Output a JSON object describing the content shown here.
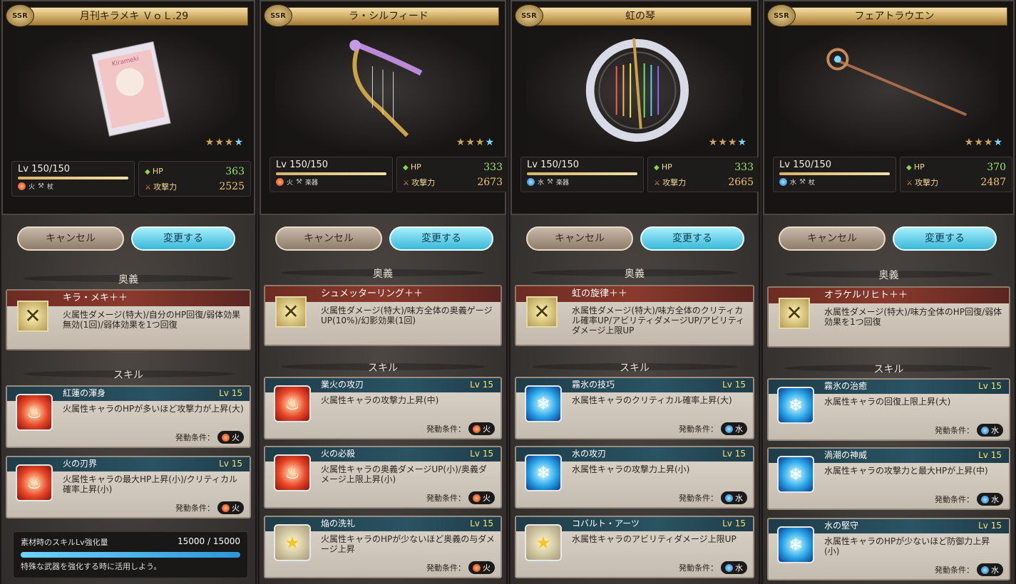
{
  "rarity_label": "SSR",
  "common": {
    "cancel": "キャンセル",
    "change": "変更する",
    "ougi_label": "奥義",
    "skill_label": "スキル",
    "trigger_label": "発動条件：",
    "hp_label": "HP",
    "atk_label": "攻撃力",
    "stars_gold": "★★★",
    "stars_blue": "★"
  },
  "colors": {
    "fire": "#d23a10",
    "water": "#1673c7",
    "gold": "#caa55c",
    "hp": "#9be86a"
  },
  "panels": [
    {
      "title": "月刊キラメキ ＶｏＬ.29",
      "level": "Lv 150/150",
      "element": "火",
      "element_icon": "fire-icon",
      "weapon_type": "杖",
      "hp": "363",
      "atk": "2525",
      "ougi": {
        "name": "キラ・メキ＋＋",
        "desc": "火属性ダメージ(特大)/自分のHP回復/弱体効果無効(1回)/弱体効果を1つ回復"
      },
      "skills": [
        {
          "name": "紅蓮の渾身",
          "lv": "Lv 15",
          "desc": "火属性キャラのHPが多いほど攻撃力が上昇(大)",
          "cond": "火",
          "icon": "fire-icon"
        },
        {
          "name": "火の刃界",
          "lv": "Lv 15",
          "desc": "火属性キャラの最大HP上昇(小)/クリティカル確率上昇(小)",
          "cond": "火",
          "icon": "fire-icon"
        }
      ],
      "material": {
        "label": "素材時のスキルLv強化量",
        "value": "15000 / 15000",
        "fill": 1.0,
        "note": "特殊な武器を強化する時に活用しよう。"
      }
    },
    {
      "title": "ラ・シルフィード",
      "level": "Lv 150/150",
      "element": "火",
      "element_icon": "fire-icon",
      "weapon_type": "楽器",
      "hp": "333",
      "atk": "2673",
      "ougi": {
        "name": "シュメッターリング＋＋",
        "desc": "火属性ダメージ(特大)/味方全体の奥義ゲージUP(10%)/幻影効果(1回)"
      },
      "skills": [
        {
          "name": "業火の攻刃",
          "lv": "Lv 15",
          "desc": "火属性キャラの攻撃力上昇(中)",
          "cond": "火",
          "icon": "fire-icon"
        },
        {
          "name": "火の必殺",
          "lv": "Lv 15",
          "desc": "火属性キャラの奥義ダメージUP(小)/奥義ダメージ上限上昇(小)",
          "cond": "火",
          "icon": "fire-icon"
        },
        {
          "name": "焔の洗礼",
          "lv": "Lv 15",
          "desc": "火属性キャラのHPが少ないほど奥義の与ダメージ上昇",
          "cond": "火",
          "icon": "star-icon"
        }
      ]
    },
    {
      "title": "虹の琴",
      "level": "Lv 150/150",
      "element": "水",
      "element_icon": "water-icon",
      "weapon_type": "楽器",
      "hp": "333",
      "atk": "2665",
      "ougi": {
        "name": "虹の旋律＋＋",
        "desc": "水属性ダメージ(特大)/味方全体のクリティカル確率UP/アビリティダメージUP/アビリティダメージ上限UP"
      },
      "skills": [
        {
          "name": "霧氷の技巧",
          "lv": "Lv 15",
          "desc": "水属性キャラのクリティカル確率上昇(大)",
          "cond": "水",
          "icon": "water-icon"
        },
        {
          "name": "水の攻刃",
          "lv": "Lv 15",
          "desc": "水属性キャラの攻撃力上昇(小)",
          "cond": "水",
          "icon": "water-icon"
        },
        {
          "name": "コバルト・アーツ",
          "lv": "Lv 15",
          "desc": "水属性キャラのアビリティダメージ上限UP",
          "cond": "水",
          "icon": "star-icon"
        }
      ]
    },
    {
      "title": "フェアトラウエン",
      "level": "Lv 150/150",
      "element": "水",
      "element_icon": "water-icon",
      "weapon_type": "杖",
      "hp": "370",
      "atk": "2487",
      "ougi": {
        "name": "オラケルリヒト＋＋",
        "desc": "水属性ダメージ(特大)/味方全体のHP回復/弱体効果を1つ回復"
      },
      "skills": [
        {
          "name": "霧氷の治癒",
          "lv": "Lv 15",
          "desc": "水属性キャラの回復上限上昇(大)",
          "cond": "水",
          "icon": "water-icon"
        },
        {
          "name": "渦潮の神威",
          "lv": "Lv 15",
          "desc": "水属性キャラの攻撃力と最大HPが上昇(中)",
          "cond": "水",
          "icon": "water-icon"
        },
        {
          "name": "水の堅守",
          "lv": "Lv 15",
          "desc": "水属性キャラのHPが少ないほど防御力上昇(小)",
          "cond": "水",
          "icon": "water-icon"
        }
      ]
    }
  ]
}
